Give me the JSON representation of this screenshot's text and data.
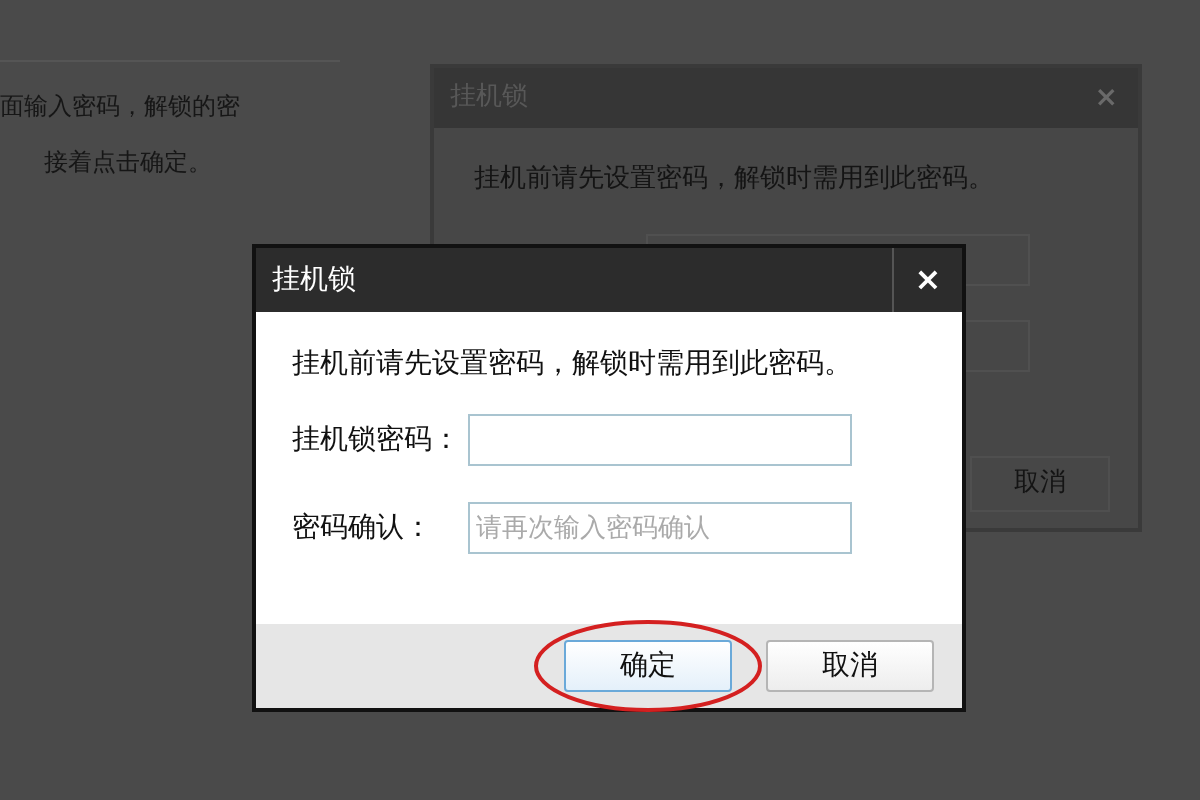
{
  "background_text": [
    "面输入密码，解锁的密",
    "接着点击确定。"
  ],
  "back_dialog": {
    "title": "挂机锁",
    "close": "×",
    "message": "挂机前请先设置密码，解锁时需用到此密码。",
    "buttons": [
      {
        "label": "取消"
      }
    ]
  },
  "dialog": {
    "title": "挂机锁",
    "close": "×",
    "message": "挂机前请先设置密码，解锁时需用到此密码。",
    "fields": [
      {
        "label": "挂机锁密码："
      },
      {
        "label": "密码确认：",
        "placeholder": "请再次输入密码确认"
      }
    ],
    "buttons": [
      {
        "label": "确定",
        "kind": "primary",
        "highlighted": true
      },
      {
        "label": "取消",
        "kind": "secondary",
        "highlighted": false
      }
    ]
  }
}
